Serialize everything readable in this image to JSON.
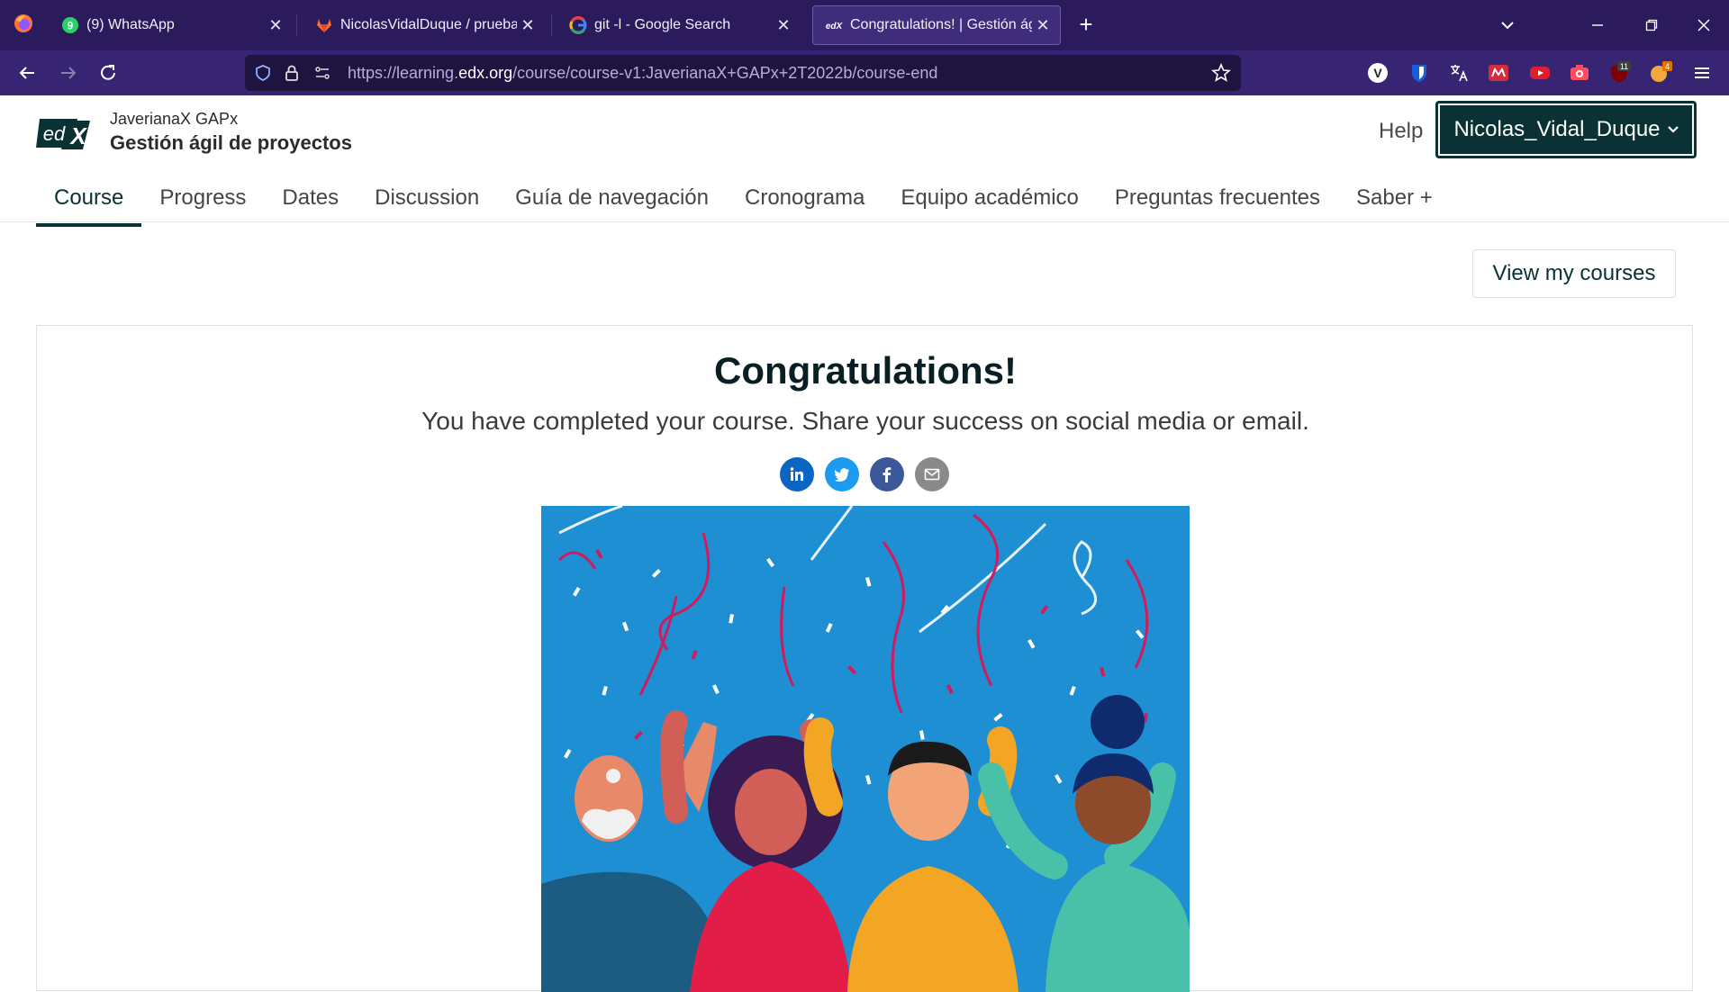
{
  "browser": {
    "tabs": [
      {
        "title": "(9) WhatsApp",
        "badge": "9",
        "active": false
      },
      {
        "title": "NicolasVidalDuque / prueba · G",
        "active": false
      },
      {
        "title": "git -l - Google Search",
        "active": false
      },
      {
        "title": "Congratulations! | Gestión ágil d",
        "active": true
      }
    ],
    "url_prefix": "https://learning.",
    "url_domain": "edx.org",
    "url_path": "/course/course-v1:JaverianaX+GAPx+2T2022b/course-end",
    "ext_badges": {
      "ublock": "11",
      "addon": "4"
    }
  },
  "header": {
    "logo_text": "edX",
    "course_org": "JaverianaX GAPx",
    "course_name": "Gestión ágil de proyectos",
    "help_label": "Help",
    "username": "Nicolas_Vidal_Duque"
  },
  "course_tabs": [
    {
      "label": "Course",
      "active": true
    },
    {
      "label": "Progress"
    },
    {
      "label": "Dates"
    },
    {
      "label": "Discussion"
    },
    {
      "label": "Guía de navegación"
    },
    {
      "label": "Cronograma"
    },
    {
      "label": "Equipo académico"
    },
    {
      "label": "Preguntas frecuentes"
    },
    {
      "label": "Saber +"
    }
  ],
  "main": {
    "view_courses_label": "View my courses",
    "title": "Congratulations!",
    "subtitle": "You have completed your course. Share your success on social media or email.",
    "share": [
      {
        "name": "linkedin-icon",
        "color": "#0a66c2"
      },
      {
        "name": "twitter-icon",
        "color": "#1d9bf0"
      },
      {
        "name": "facebook-icon",
        "color": "#3b5998"
      },
      {
        "name": "email-icon",
        "color": "#8a8a8a"
      }
    ]
  },
  "colors": {
    "tabbar": "#2b1a5c",
    "navbar": "#372472",
    "brand_dark": "#0a3133",
    "celebration_bg": "#1d8fd2"
  }
}
